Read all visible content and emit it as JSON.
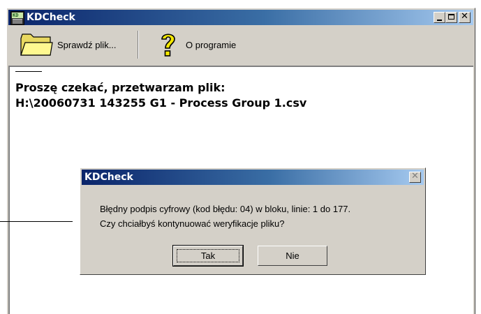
{
  "window": {
    "title": "KDCheck",
    "icon_label": "KD",
    "controls": {
      "minimize": "minimize-icon",
      "maximize": "maximize-icon",
      "close": "close-icon"
    }
  },
  "toolbar": {
    "open_label": "Sprawdź plik...",
    "about_label": "O programie",
    "icons": {
      "open": "folder-icon",
      "about": "question-mark-icon"
    }
  },
  "content": {
    "line1": "Proszę czekać, przetwarzam plik:",
    "line2": "H:\\20060731 143255 G1 - Process Group 1.csv"
  },
  "dialog": {
    "title": "KDCheck",
    "message_line1": "Błędny podpis cyfrowy (kod błędu: 04) w bloku, linie: 1 do 177.",
    "message_line2": "Czy chciałbyś kontynuować weryfikacje pliku?",
    "yes_label": "Tak",
    "no_label": "Nie"
  },
  "colors": {
    "titlebar_start": "#0a246a",
    "titlebar_end": "#a6caf0",
    "face": "#d4d0c8"
  }
}
